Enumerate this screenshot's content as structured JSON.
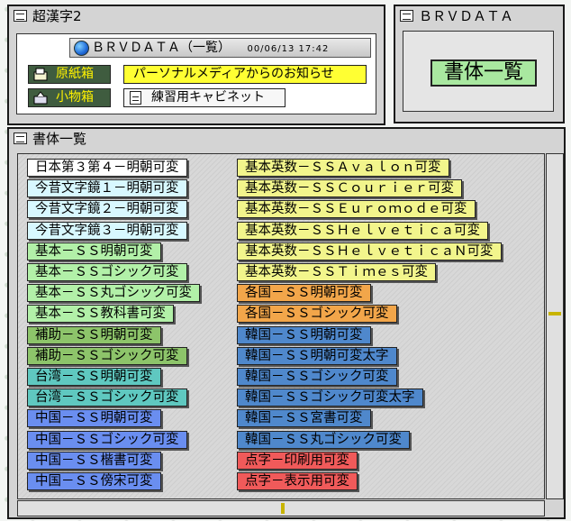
{
  "window1": {
    "title": "超漢字2",
    "header": {
      "title": "ＢＲＶＤＡＴＡ（一覧）",
      "date": "00/06/13 17:42"
    },
    "buttons": [
      {
        "label": "原紙箱",
        "icon": "paper-box-icon"
      },
      {
        "label": "小物箱",
        "icon": "tool-box-icon"
      }
    ],
    "notice": "パーソナルメディアからのお知らせ",
    "cabinet": "練習用キャビネット"
  },
  "window2": {
    "title": "ＢＲＶＤＡＴＡ",
    "button": "書体一覧"
  },
  "window3": {
    "title": "書体一覧",
    "left_items": [
      {
        "label": "日本第３第４－明朝可変",
        "color": "#ffffff"
      },
      {
        "label": "今昔文字鏡１－明朝可変",
        "color": "#d8f8ff"
      },
      {
        "label": "今昔文字鏡２－明朝可変",
        "color": "#d8f8ff"
      },
      {
        "label": "今昔文字鏡３－明朝可変",
        "color": "#d8f8ff"
      },
      {
        "label": "基本－ＳＳ明朝可変",
        "color": "#b2f0a8"
      },
      {
        "label": "基本－ＳＳゴシック可変",
        "color": "#b2f0a8"
      },
      {
        "label": "基本－ＳＳ丸ゴシック可変",
        "color": "#b2f0a8"
      },
      {
        "label": "基本－ＳＳ教科書可変",
        "color": "#b2f0a8"
      },
      {
        "label": "補助－ＳＳ明朝可変",
        "color": "#8dc46a"
      },
      {
        "label": "補助－ＳＳゴシック可変",
        "color": "#8dc46a"
      },
      {
        "label": "台湾－ＳＳ明朝可変",
        "color": "#5fc8c0"
      },
      {
        "label": "台湾－ＳＳゴシック可変",
        "color": "#5fc8c0"
      },
      {
        "label": "中国－ＳＳ明朝可変",
        "color": "#6a8ef0"
      },
      {
        "label": "中国－ＳＳゴシック可変",
        "color": "#6a8ef0"
      },
      {
        "label": "中国－ＳＳ楷書可変",
        "color": "#6a8ef0"
      },
      {
        "label": "中国－ＳＳ傍宋可変",
        "color": "#6a8ef0"
      }
    ],
    "right_items": [
      {
        "label": "基本英数－ＳＳＡｖａｌｏｎ可変",
        "color": "#f2f58c"
      },
      {
        "label": "基本英数－ＳＳＣｏｕｒｉｅｒ可変",
        "color": "#f2f58c"
      },
      {
        "label": "基本英数－ＳＳＥｕｒｏｍｏｄｅ可変",
        "color": "#f2f58c"
      },
      {
        "label": "基本英数－ＳＳＨｅｌｖｅｔｉｃａ可変",
        "color": "#f2f58c"
      },
      {
        "label": "基本英数－ＳＳＨｅｌｖｅｔｉｃａＮ可変",
        "color": "#f2f58c"
      },
      {
        "label": "基本英数－ＳＳＴｉｍｅｓ可変",
        "color": "#f2f58c"
      },
      {
        "label": "各国－ＳＳ明朝可変",
        "color": "#f2a64a"
      },
      {
        "label": "各国－ＳＳゴシック可変",
        "color": "#f2a64a"
      },
      {
        "label": "韓国－ＳＳ明朝可変",
        "color": "#4f88cc"
      },
      {
        "label": "韓国－ＳＳ明朝可変太字",
        "color": "#4f88cc"
      },
      {
        "label": "韓国－ＳＳゴシック可変",
        "color": "#4f88cc"
      },
      {
        "label": "韓国－ＳＳゴシック可変太字",
        "color": "#4f88cc"
      },
      {
        "label": "韓国－ＳＳ宮書可変",
        "color": "#4f88cc"
      },
      {
        "label": "韓国－ＳＳ丸ゴシック可変",
        "color": "#4f88cc"
      },
      {
        "label": "点字－印刷用可変",
        "color": "#f05a5a"
      },
      {
        "label": "点字－表示用可変",
        "color": "#f05a5a"
      }
    ]
  }
}
